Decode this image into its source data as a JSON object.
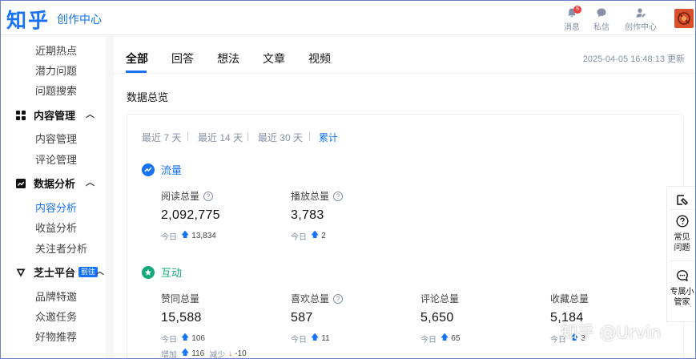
{
  "header": {
    "logo": "知乎",
    "subtitle": "创作中心",
    "messages_label": "消息",
    "messages_badge": "5",
    "dm_label": "私信",
    "creator_label": "创作中心"
  },
  "sidebar": {
    "top_items": [
      "近期热点",
      "潜力问题",
      "问题搜索"
    ],
    "content_mgmt": {
      "title": "内容管理",
      "items": [
        "内容管理",
        "评论管理"
      ]
    },
    "data_analysis": {
      "title": "数据分析",
      "items": [
        "内容分析",
        "收益分析",
        "关注者分析"
      ]
    },
    "zhishi": {
      "title": "芝士平台",
      "tag": "前往",
      "items": [
        "品牌特邀",
        "众邀任务",
        "好物推荐"
      ]
    },
    "active_item": "内容分析"
  },
  "tabs": [
    "全部",
    "回答",
    "想法",
    "文章",
    "视频"
  ],
  "active_tab": "全部",
  "updated": "2025-04-05 16:48:13 更新",
  "section_title": "数据总览",
  "ranges": [
    "最近 7 天",
    "最近 14 天",
    "最近 30 天",
    "累计"
  ],
  "active_range": "累计",
  "traffic": {
    "title": "流量",
    "reads": {
      "label": "阅读总量",
      "value": "2,092,775",
      "today_label": "今日",
      "today": "13,834"
    },
    "plays": {
      "label": "播放总量",
      "value": "3,783",
      "today_label": "今日",
      "today": "2"
    }
  },
  "interaction": {
    "title": "互动",
    "likes": {
      "label": "赞同总量",
      "value": "15,588",
      "today_label": "今日",
      "today": "106",
      "inc_label": "增加",
      "inc": "116",
      "dec_label": "减少",
      "dec": "-10"
    },
    "favs": {
      "label": "喜欢总量",
      "value": "587",
      "today_label": "今日",
      "today": "11"
    },
    "comments": {
      "label": "评论总量",
      "value": "5,650",
      "today_label": "今日",
      "today": "65"
    },
    "collects": {
      "label": "收藏总量",
      "value": "5,184",
      "today_label": "今日",
      "today": "3"
    }
  },
  "float_panel": {
    "faq": "常见问题",
    "steward": "专属小管家"
  },
  "watermark": "知乎 @Urvin",
  "colors": {
    "brand": "#1772f6",
    "interaction": "#12a97a",
    "down": "#f1403c"
  }
}
